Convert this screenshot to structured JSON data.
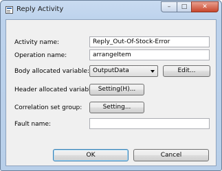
{
  "window": {
    "title": "Reply Activity"
  },
  "fields": {
    "activity_name": {
      "label": "Activity name:",
      "value": "Reply_Out-Of-Stock-Error"
    },
    "operation_name": {
      "label": "Operation name:",
      "value": "arrangeItem"
    },
    "body_variable": {
      "label": "Body allocated variable:",
      "value": "OutputData",
      "edit_button": "Edit..."
    },
    "header_variable": {
      "label": "Header allocated variable:",
      "button": "Setting(H)..."
    },
    "correlation_set": {
      "label": "Correlation set group:",
      "button": "Setting..."
    },
    "fault_name": {
      "label": "Fault name:",
      "value": ""
    }
  },
  "buttons": {
    "ok": "OK",
    "cancel": "Cancel"
  },
  "icons": {
    "app": "dialog-icon",
    "minimize": "minimize-icon",
    "maximize": "maximize-icon",
    "close": "close-icon"
  }
}
